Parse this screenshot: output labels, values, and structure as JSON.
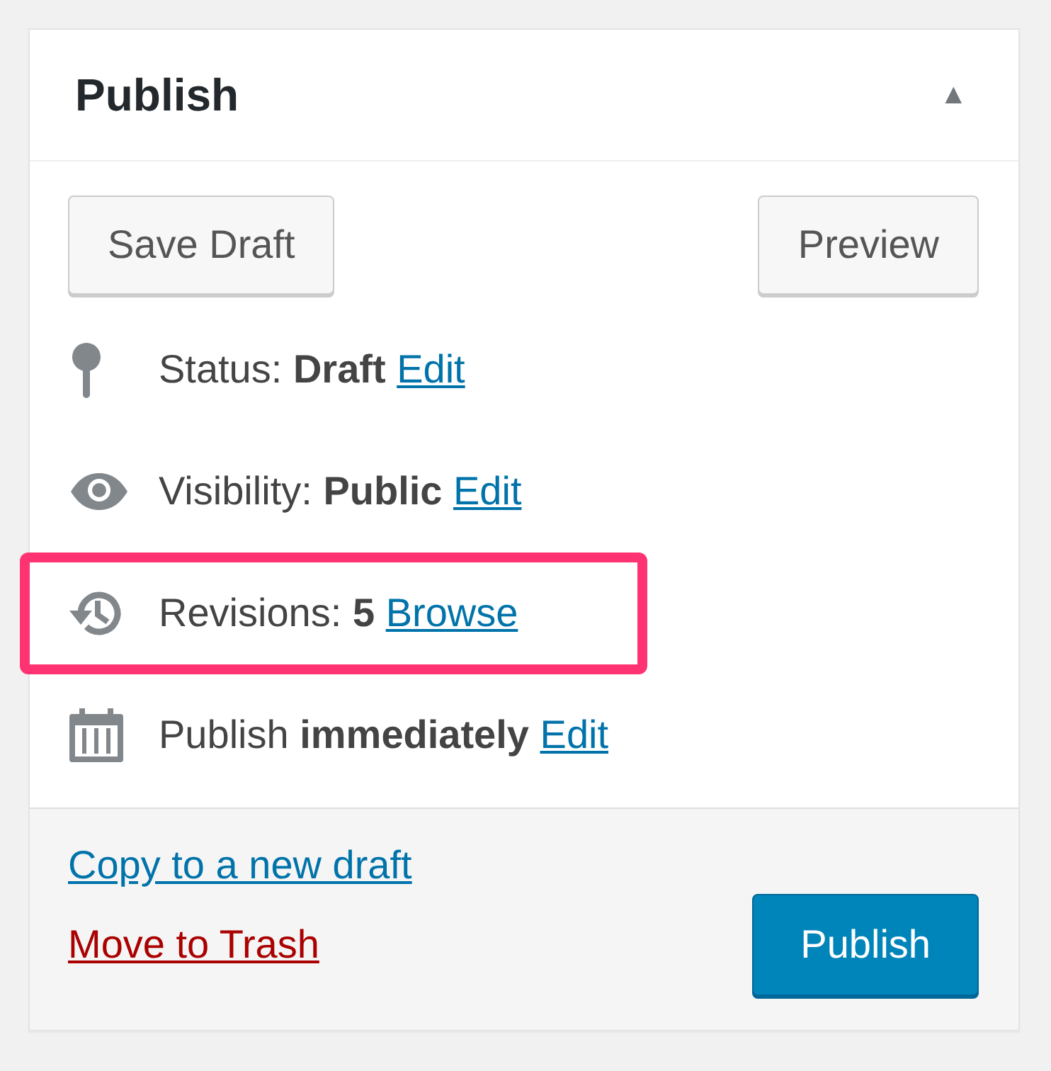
{
  "panel": {
    "title": "Publish",
    "collapse_icon": "▲"
  },
  "actions": {
    "save_draft": "Save Draft",
    "preview": "Preview"
  },
  "rows": [
    {
      "kind": "status",
      "label": "Status:",
      "value": "Draft",
      "link": "Edit",
      "highlighted": false
    },
    {
      "kind": "visibility",
      "label": "Visibility:",
      "value": "Public",
      "link": "Edit",
      "highlighted": false
    },
    {
      "kind": "revisions",
      "label": "Revisions:",
      "value": "5",
      "link": "Browse",
      "highlighted": true
    },
    {
      "kind": "schedule",
      "label": "Publish",
      "value": "immediately",
      "link": "Edit",
      "highlighted": false
    }
  ],
  "footer": {
    "copy_link": "Copy to a new draft",
    "trash_link": "Move to Trash",
    "publish_button": "Publish"
  }
}
